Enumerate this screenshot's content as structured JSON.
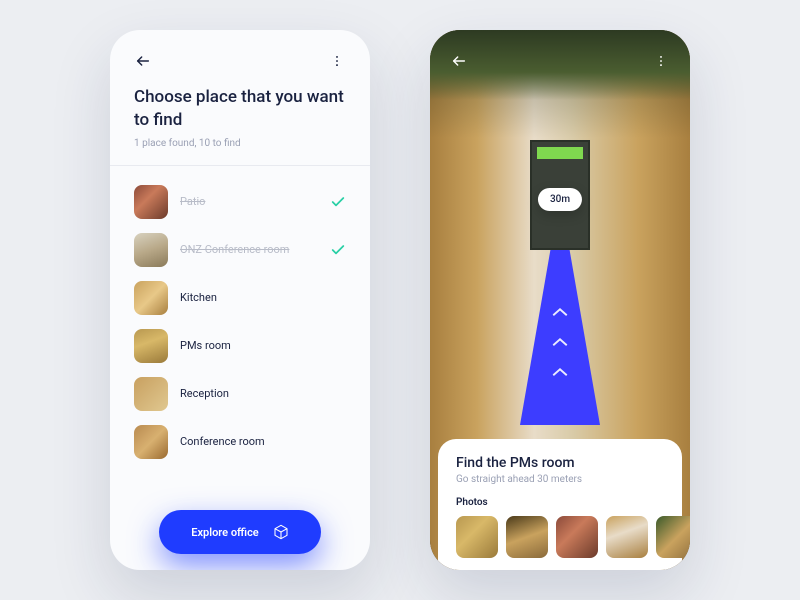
{
  "screen1": {
    "title": "Choose place that you want to find",
    "subtitle": "1 place found, 10 to find",
    "items": [
      {
        "label": "Patio",
        "done": true
      },
      {
        "label": "ONZ Conference room",
        "done": true
      },
      {
        "label": "Kitchen",
        "done": false
      },
      {
        "label": "PMs room",
        "done": false
      },
      {
        "label": "Reception",
        "done": false
      },
      {
        "label": "Conference room",
        "done": false
      }
    ],
    "cta": "Explore office"
  },
  "screen2": {
    "distance": "30m",
    "card_title": "Find the PMs room",
    "card_subtitle": "Go straight ahead 30 meters",
    "photos_label": "Photos"
  }
}
